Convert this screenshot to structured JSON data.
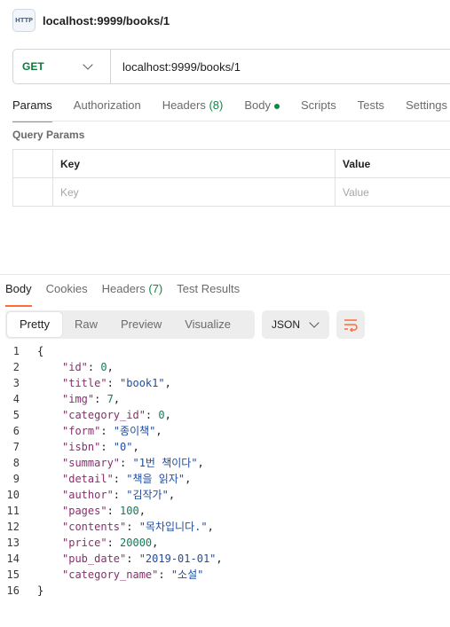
{
  "tab": {
    "icon": "http-icon",
    "icon_text": "HTTP",
    "title": "localhost:9999/books/1"
  },
  "request": {
    "method": "GET",
    "url": "localhost:9999/books/1"
  },
  "request_tabs": [
    {
      "label": "Params",
      "count": ""
    },
    {
      "label": "Authorization",
      "count": ""
    },
    {
      "label": "Headers",
      "count": "(8)"
    },
    {
      "label": "Body",
      "count": ""
    },
    {
      "label": "Scripts",
      "count": ""
    },
    {
      "label": "Tests",
      "count": ""
    },
    {
      "label": "Settings",
      "count": ""
    }
  ],
  "query_params": {
    "title": "Query Params",
    "key_header": "Key",
    "value_header": "Value",
    "key_placeholder": "Key",
    "value_placeholder": "Value"
  },
  "response_tabs": [
    {
      "label": "Body"
    },
    {
      "label": "Cookies"
    },
    {
      "label": "Headers",
      "count": "(7)"
    },
    {
      "label": "Test Results"
    }
  ],
  "view_modes": [
    "Pretty",
    "Raw",
    "Preview",
    "Visualize"
  ],
  "format": "JSON",
  "code": {
    "open": "{",
    "close": "}",
    "fields": [
      {
        "key": "\"id\"",
        "value": "0",
        "kind": "num"
      },
      {
        "key": "\"title\"",
        "value": "\"book1\"",
        "kind": "str"
      },
      {
        "key": "\"img\"",
        "value": "7",
        "kind": "num"
      },
      {
        "key": "\"category_id\"",
        "value": "0",
        "kind": "num"
      },
      {
        "key": "\"form\"",
        "value": "\"종이책\"",
        "kind": "str"
      },
      {
        "key": "\"isbn\"",
        "value": "\"0\"",
        "kind": "str"
      },
      {
        "key": "\"summary\"",
        "value": "\"1번 책이다\"",
        "kind": "str"
      },
      {
        "key": "\"detail\"",
        "value": "\"책을 읽자\"",
        "kind": "str"
      },
      {
        "key": "\"author\"",
        "value": "\"김작가\"",
        "kind": "str"
      },
      {
        "key": "\"pages\"",
        "value": "100",
        "kind": "num"
      },
      {
        "key": "\"contents\"",
        "value": "\"목차입니다.\"",
        "kind": "str"
      },
      {
        "key": "\"price\"",
        "value": "20000",
        "kind": "num"
      },
      {
        "key": "\"pub_date\"",
        "value": "\"2019-01-01\"",
        "kind": "str"
      },
      {
        "key": "\"category_name\"",
        "value": "\"소설\"",
        "kind": "str"
      }
    ]
  },
  "colors": {
    "accent": "#ff6c37",
    "method_get": "#0b7a3d",
    "json_key": "#8a2e6d",
    "json_string": "#1f4ea3",
    "json_number": "#0e7c5a"
  }
}
